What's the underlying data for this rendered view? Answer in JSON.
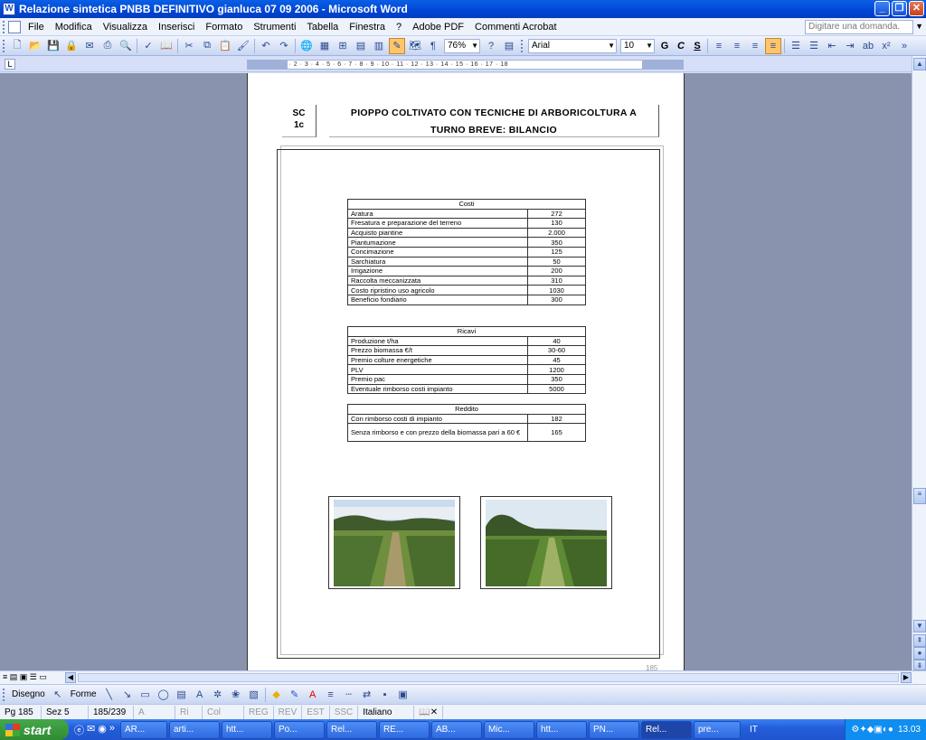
{
  "window": {
    "title": "Relazione sintetica PNBB DEFINITIVO gianluca 07 09 2006 - Microsoft Word"
  },
  "menu": [
    "File",
    "Modifica",
    "Visualizza",
    "Inserisci",
    "Formato",
    "Strumenti",
    "Tabella",
    "Finestra",
    "?",
    "Adobe PDF",
    "Commenti Acrobat"
  ],
  "ask_placeholder": "Digitare una domanda.",
  "toolbar": {
    "zoom": "76%",
    "font": "Arial",
    "size": "10",
    "bold": "G",
    "italic": "C",
    "underline": "S"
  },
  "ruler": "2 · 1 · ⌂ · 1 · 2 · 3 · 4 · 5 · 6 · 7 · 8 · 9 · 10 · 11 · 12 · 13 · 14 · 15 · 16 · 17 · 18",
  "doc": {
    "code": [
      "SC",
      "1c"
    ],
    "title": [
      "PIOPPO COLTIVATO CON TECNICHE DI ARBORICOLTURA A",
      "TURNO BREVE: BILANCIO"
    ],
    "costi": {
      "header": "Costi",
      "rows": [
        [
          "Aratura",
          "272"
        ],
        [
          "Fresatura e preparazione del terreno",
          "130"
        ],
        [
          "Acquisto piantine",
          "2.000"
        ],
        [
          "Piantumazione",
          "350"
        ],
        [
          "Concimazione",
          "125"
        ],
        [
          "Sarchiatura",
          "50"
        ],
        [
          "Irrigazione",
          "200"
        ],
        [
          "Raccolta meccanizzata",
          "310"
        ],
        [
          "Costo ripristino uso agricolo",
          "1030"
        ],
        [
          "Beneficio fondiario",
          "300"
        ]
      ]
    },
    "ricavi": {
      "header": "Ricavi",
      "rows": [
        [
          "Produzione t/ha",
          "40"
        ],
        [
          "Prezzo biomassa €/t",
          "30-60"
        ],
        [
          "Premio colture energetiche",
          "45"
        ],
        [
          "PLV",
          "1200"
        ],
        [
          "Premio pac",
          "350"
        ],
        [
          "Eventuale rimborso costi impianto",
          "5000"
        ]
      ]
    },
    "reddito": {
      "header": "Reddito",
      "rows": [
        [
          "Con rimborso costi di impianto",
          "182"
        ],
        [
          "Senza rimborso e con prezzo della biomassa pari a 60 €",
          "165"
        ]
      ]
    },
    "page_number": "185"
  },
  "drawbar": {
    "draw": "Disegno",
    "shapes": "Forme"
  },
  "status": [
    "Pg 185",
    "Sez 5",
    "185/239",
    "A",
    "Ri",
    "Col",
    "REG",
    "REV",
    "EST",
    "SSC",
    "Italiano (Ital"
  ],
  "taskbar": {
    "start": "start",
    "tasks": [
      "AR...",
      "arti...",
      "htt...",
      "Po...",
      "Rel...",
      "RE...",
      "AB...",
      "Mic...",
      "htt...",
      "PN...",
      "Rel...",
      "pre..."
    ],
    "lang": "IT",
    "clock": "13.03"
  }
}
